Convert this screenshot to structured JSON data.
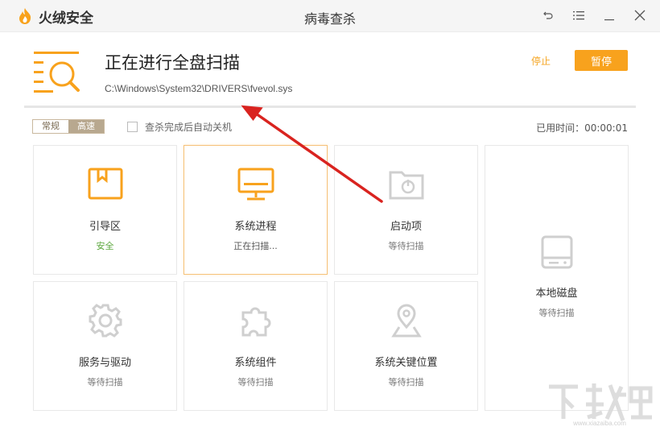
{
  "app": {
    "brand": "火绒安全",
    "window_title": "病毒查杀"
  },
  "scan": {
    "title": "正在进行全盘扫描",
    "current_path": "C:\\Windows\\System32\\DRIVERS\\fvevol.sys",
    "stop_label": "停止",
    "pause_label": "暂停",
    "elapsed": "已用时间：00:00:01"
  },
  "mode": {
    "normal": "常规",
    "fast": "高速"
  },
  "auto_shutdown_label": "查杀完成后自动关机",
  "tiles": [
    {
      "name": "引导区",
      "status": "安全",
      "icon": "boot-sector-icon"
    },
    {
      "name": "系统进程",
      "status": "正在扫描...",
      "icon": "monitor-icon"
    },
    {
      "name": "启动项",
      "status": "等待扫描",
      "icon": "startup-folder-icon"
    },
    {
      "name": "本地磁盘",
      "status": "等待扫描",
      "icon": "disk-icon"
    },
    {
      "name": "服务与驱动",
      "status": "等待扫描",
      "icon": "gear-icon"
    },
    {
      "name": "系统组件",
      "status": "等待扫描",
      "icon": "puzzle-icon"
    },
    {
      "name": "系统关键位置",
      "status": "等待扫描",
      "icon": "location-pin-icon"
    }
  ],
  "watermark": {
    "text": "下载吧",
    "url": "www.xiazaiba.com"
  },
  "colors": {
    "accent": "#f8a21d",
    "safe": "#5aa63b",
    "arrow": "#d9231f"
  }
}
